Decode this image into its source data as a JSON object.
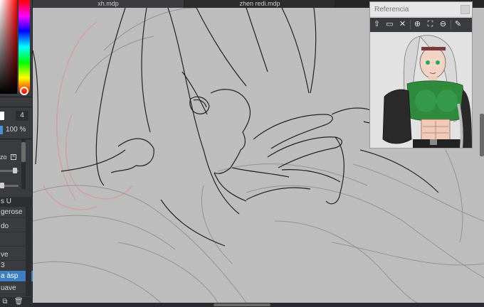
{
  "tabs": [
    {
      "label": "xh.mdp",
      "active": true
    },
    {
      "label": "zhen redi.mdp",
      "active": false
    }
  ],
  "left_panel": {
    "brush_size": "4",
    "opacity": "100 %",
    "brush_label": "zo",
    "list_header": "s U",
    "list_items": [
      {
        "label": "gerose",
        "active": false
      },
      {
        "label": "do",
        "active": false
      },
      {
        "label": "",
        "active": false
      },
      {
        "label": "ve",
        "active": false
      },
      {
        "label": "3",
        "active": false
      },
      {
        "label": "a àsp",
        "active": true
      },
      {
        "label": "uave",
        "active": false
      }
    ]
  },
  "reference": {
    "title": "Referencia",
    "tools": [
      "upload-icon",
      "open-folder-icon",
      "close-icon",
      "zoom-in-icon",
      "fit-icon",
      "zoom-out-icon",
      "eyedropper-icon"
    ]
  },
  "colors": {
    "accent": "#3d7fc4",
    "canvas": "#bdbdbd",
    "panel": "#3a3b3e"
  }
}
